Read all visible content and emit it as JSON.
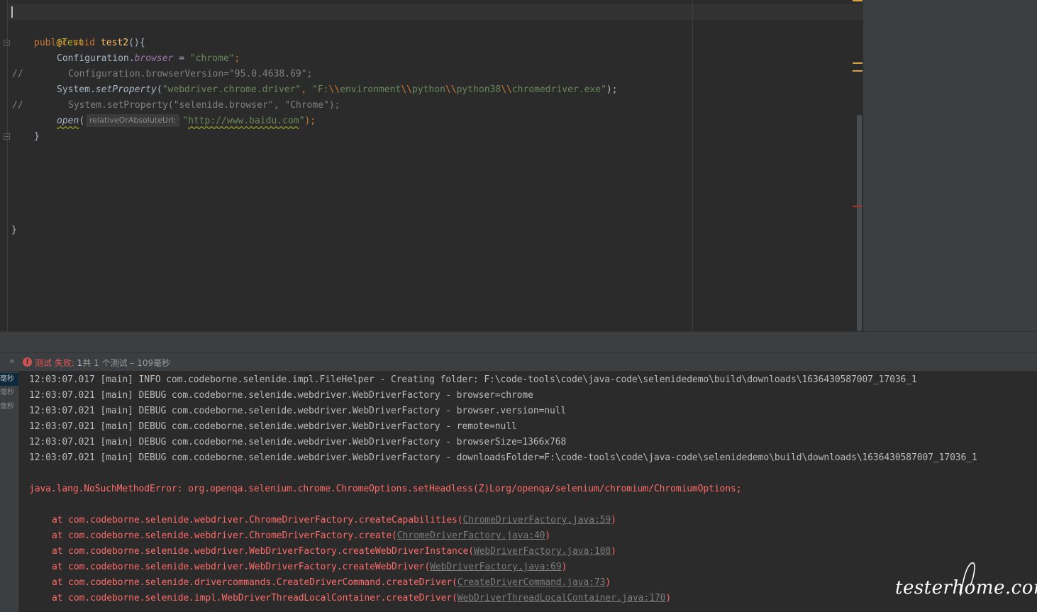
{
  "editor": {
    "annotation": "@Test",
    "method_decl": {
      "kw_public": "public",
      "kw_void": "void",
      "name": "test2",
      "rest": "(){"
    },
    "line_browser": {
      "cls": "Configuration.",
      "field": "browser",
      "eq": " = ",
      "value": "\"chrome\"",
      "semi": ";"
    },
    "line_version_comment": "Configuration.browserVersion=\"95.0.4638.69\";",
    "line_setproperty": {
      "cls": "System.",
      "method": "setProperty",
      "open": "(",
      "arg1": "\"webdriver.chrome.driver\"",
      "sep": ", ",
      "p1": "\"F:",
      "e1": "\\\\",
      "p2": "environment",
      "e2": "\\\\",
      "p3": "python",
      "e3": "\\\\",
      "p4": "python38",
      "e4": "\\\\",
      "p5": "chromedriver.exe\"",
      "close": ");"
    },
    "line_setproperty_comment": "System.setProperty(\"selenide.browser\", \"Chrome\");",
    "line_open": {
      "method": "open",
      "paren": "(",
      "hint": "relativeOrAbsoluteUrl:",
      "q1": "\"",
      "url": "http://www.baidu.com",
      "q2": "\"",
      "close": ");"
    },
    "comment_marker": "//",
    "close_method": "}",
    "close_class": "}"
  },
  "run_panel": {
    "expand": "»",
    "error_icon": "!",
    "status_fail": "测试 失败:",
    "status_count": " 1",
    "status_rest": "共 1 个测试 – 109毫秒",
    "tree_items": [
      "毫秒",
      "毫秒",
      "毫秒"
    ],
    "log_lines": [
      "12:03:07.017 [main] INFO com.codeborne.selenide.impl.FileHelper - Creating folder: F:\\code-tools\\code\\java-code\\selenidedemo\\build\\downloads\\1636430587007_17036_1",
      "12:03:07.021 [main] DEBUG com.codeborne.selenide.webdriver.WebDriverFactory - browser=chrome",
      "12:03:07.021 [main] DEBUG com.codeborne.selenide.webdriver.WebDriverFactory - browser.version=null",
      "12:03:07.021 [main] DEBUG com.codeborne.selenide.webdriver.WebDriverFactory - remote=null",
      "12:03:07.021 [main] DEBUG com.codeborne.selenide.webdriver.WebDriverFactory - browserSize=1366x768",
      "12:03:07.021 [main] DEBUG com.codeborne.selenide.webdriver.WebDriverFactory - downloadsFolder=F:\\code-tools\\code\\java-code\\selenidedemo\\build\\downloads\\1636430587007_17036_1"
    ],
    "error_line": "java.lang.NoSuchMethodError: org.openqa.selenium.chrome.ChromeOptions.setHeadless(Z)Lorg/openqa/selenium/chromium/ChromiumOptions;",
    "stack": [
      {
        "text": "at com.codeborne.selenide.webdriver.ChromeDriverFactory.createCapabilities(",
        "link": "ChromeDriverFactory.java:59",
        "end": ")"
      },
      {
        "text": "at com.codeborne.selenide.webdriver.ChromeDriverFactory.create(",
        "link": "ChromeDriverFactory.java:40",
        "end": ")"
      },
      {
        "text": "at com.codeborne.selenide.webdriver.WebDriverFactory.createWebDriverInstance(",
        "link": "WebDriverFactory.java:108",
        "end": ")"
      },
      {
        "text": "at com.codeborne.selenide.webdriver.WebDriverFactory.createWebDriver(",
        "link": "WebDriverFactory.java:69",
        "end": ")"
      },
      {
        "text": "at com.codeborne.selenide.drivercommands.CreateDriverCommand.createDriver(",
        "link": "CreateDriverCommand.java:73",
        "end": ")"
      },
      {
        "text": "at com.codeborne.selenide.impl.WebDriverThreadLocalContainer.createDriver(",
        "link": "WebDriverThreadLocalContainer.java:170",
        "end": ")"
      }
    ]
  },
  "watermark": "testerhome.com",
  "colors": {
    "editor_bg": "#2b2b2b",
    "panel_bg": "#3c3f41",
    "error_red": "#ff6b68",
    "keyword": "#cc7832",
    "string": "#6a8759"
  }
}
